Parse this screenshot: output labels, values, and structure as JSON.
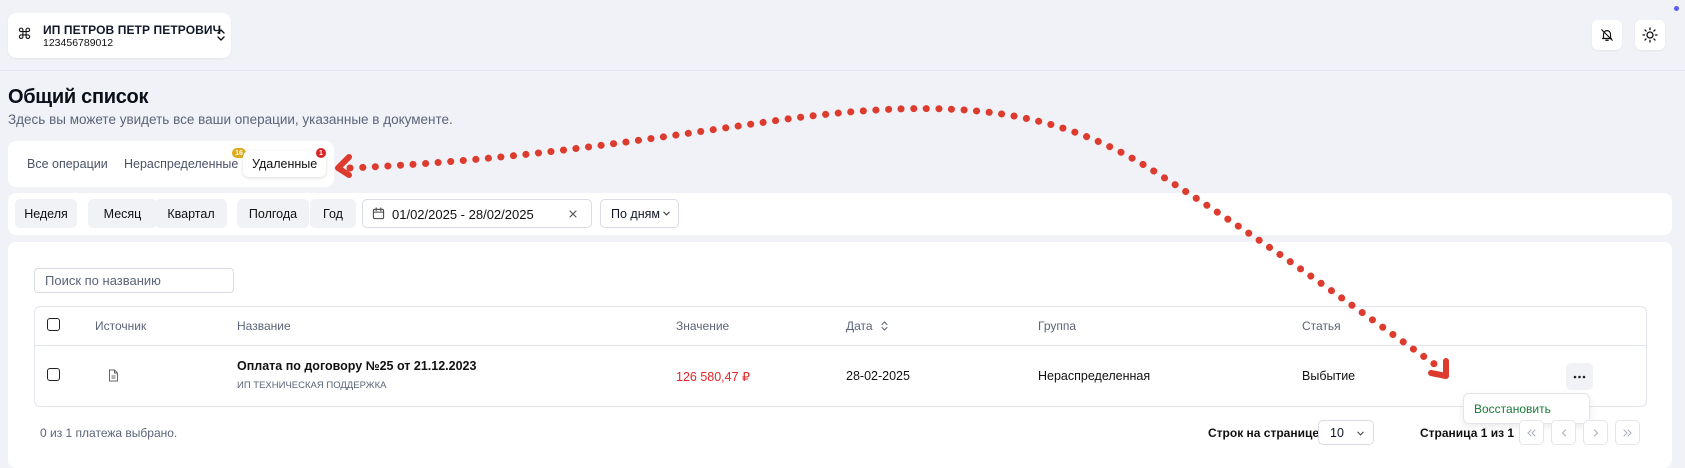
{
  "header": {
    "org_icon": "⌘",
    "org_name": "ИП ПЕТРОВ ПЕТР ПЕТРОВИЧ",
    "org_inn": "123456789012",
    "notification_icon": "bell-off-icon",
    "theme_icon": "sun-icon"
  },
  "page": {
    "title": "Общий список",
    "subtitle": "Здесь вы можете увидеть все ваши операции, указанные в документе."
  },
  "tabs": [
    {
      "label": "Все операции",
      "badge": null
    },
    {
      "label": "Нераспределенные",
      "badge": "16"
    },
    {
      "label": "Удаленные",
      "badge": "1",
      "active": true
    }
  ],
  "filters": {
    "periods": [
      "Неделя",
      "Месяц",
      "Квартал",
      "Полгода",
      "Год"
    ],
    "date_range": "01/02/2025 - 28/02/2025",
    "grouping": "По дням"
  },
  "search": {
    "placeholder": "Поиск по названию"
  },
  "table": {
    "columns": [
      "Источник",
      "Название",
      "Значение",
      "Дата",
      "Группа",
      "Статья"
    ],
    "rows": [
      {
        "source_icon": "document-icon",
        "title": "Оплата по договору №25 от 21.12.2023",
        "counterparty": "ИП ТЕХНИЧЕСКАЯ ПОДДЕРЖКА",
        "value": "126 580,47 ₽",
        "date": "28-02-2025",
        "group": "Нераспределенная",
        "article": "Выбытие"
      }
    ]
  },
  "row_menu": {
    "restore": "Восстановить"
  },
  "footer": {
    "selected": "0 из 1 платежа выбрано.",
    "rows_per_page_label": "Строк на странице",
    "rows_per_page": "10",
    "page_info": "Страница 1 из 1"
  },
  "colors": {
    "accent_negative": "#e5252a",
    "badge_warning": "#e0a91b",
    "badge_danger": "#d92525",
    "restore_green": "#1b7a3c",
    "annotation_arrow": "#dc3b2e"
  }
}
